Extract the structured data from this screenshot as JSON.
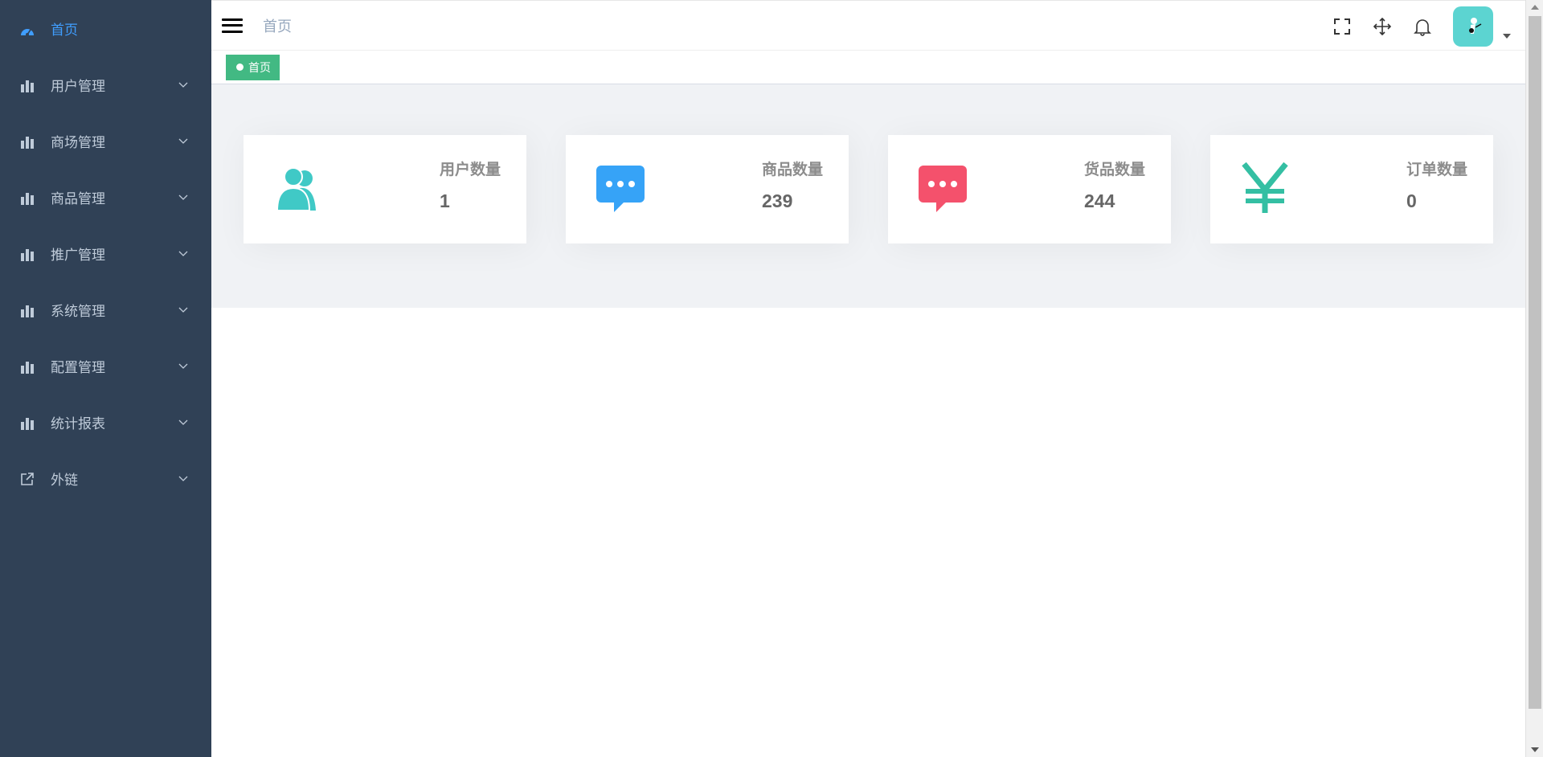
{
  "colors": {
    "sidebar_bg": "#304156",
    "sidebar_text": "#bfcbd9",
    "active": "#409eff",
    "tag_green": "#42b983",
    "users_icon": "#40c9c6",
    "goods_icon": "#36a3f7",
    "products_icon": "#f4516c",
    "orders_icon": "#34bfa3"
  },
  "sidebar": {
    "items": [
      {
        "label": "首页",
        "icon": "dashboard-icon"
      },
      {
        "label": "用户管理",
        "icon": "chart-icon"
      },
      {
        "label": "商场管理",
        "icon": "chart-icon"
      },
      {
        "label": "商品管理",
        "icon": "chart-icon"
      },
      {
        "label": "推广管理",
        "icon": "chart-icon"
      },
      {
        "label": "系统管理",
        "icon": "chart-icon"
      },
      {
        "label": "配置管理",
        "icon": "chart-icon"
      },
      {
        "label": "统计报表",
        "icon": "chart-icon"
      },
      {
        "label": "外链",
        "icon": "external-link-icon"
      }
    ]
  },
  "navbar": {
    "breadcrumb": "首页"
  },
  "tags": {
    "items": [
      {
        "label": "首页"
      }
    ]
  },
  "cards": [
    {
      "label": "用户数量",
      "value": "1",
      "icon": "users-icon"
    },
    {
      "label": "商品数量",
      "value": "239",
      "icon": "message-icon"
    },
    {
      "label": "货品数量",
      "value": "244",
      "icon": "message-icon"
    },
    {
      "label": "订单数量",
      "value": "0",
      "icon": "yen-icon"
    }
  ]
}
